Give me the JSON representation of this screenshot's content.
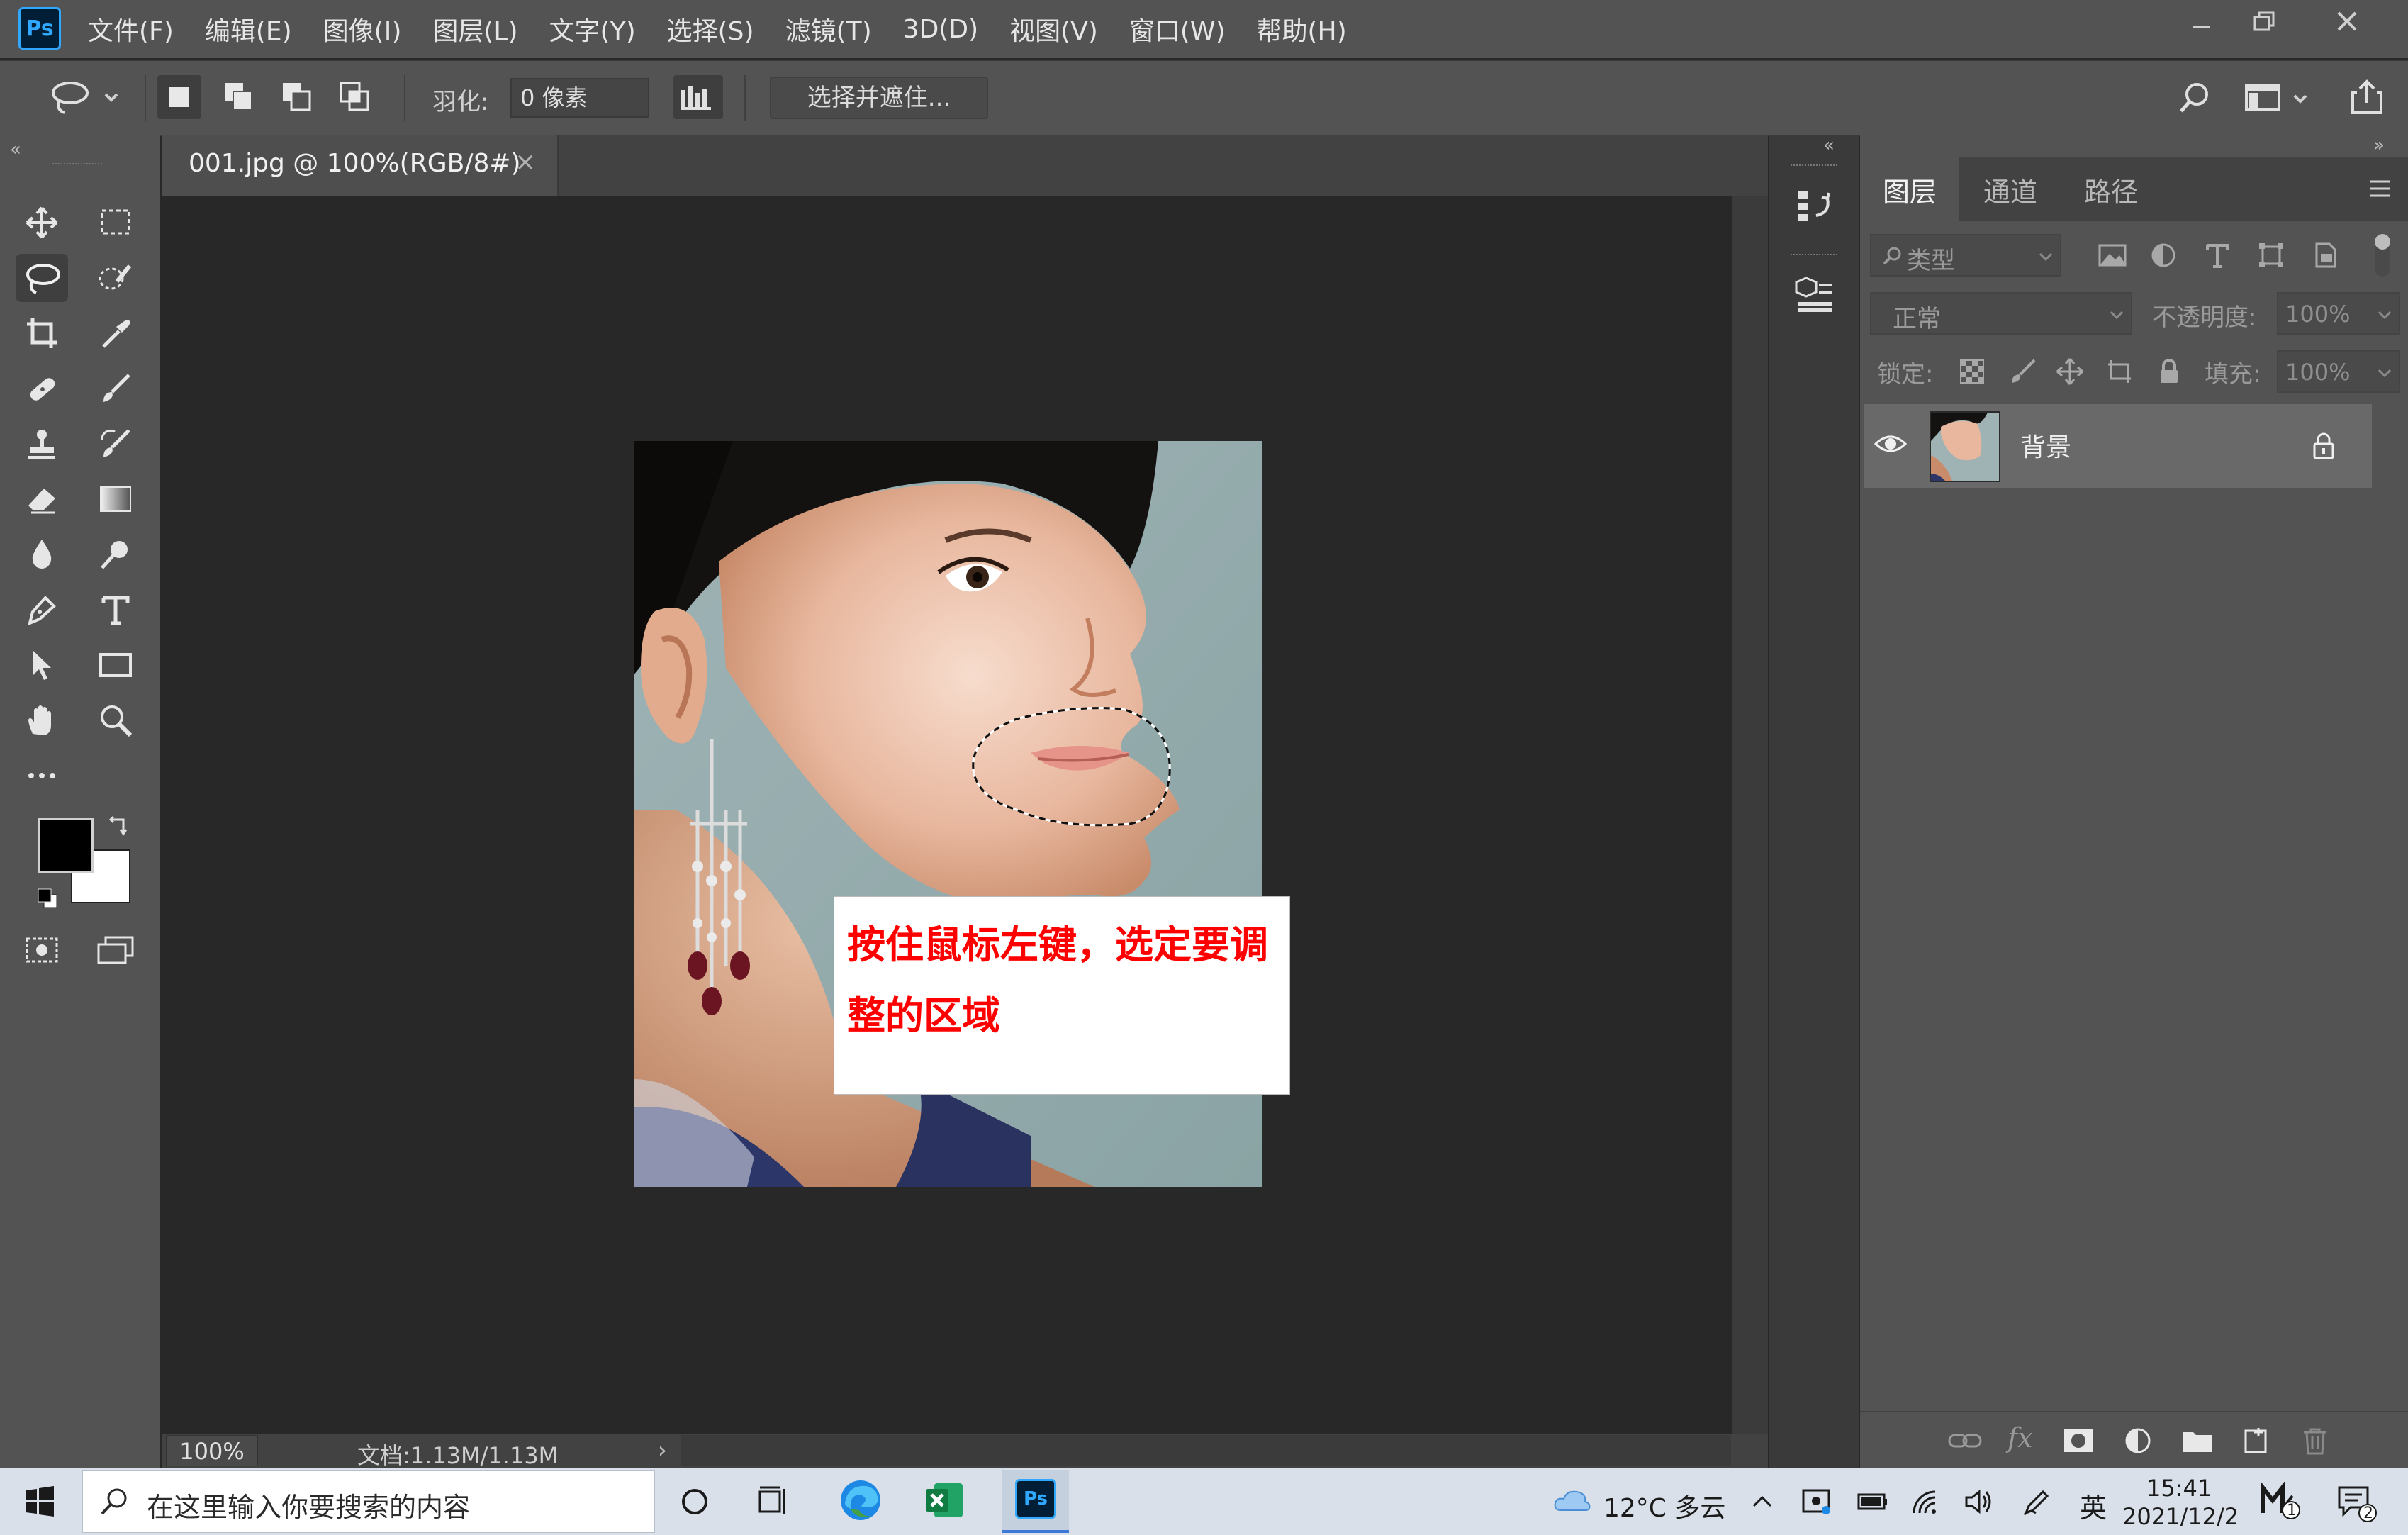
{
  "app": {
    "logo": "Ps",
    "menu": [
      "文件(F)",
      "编辑(E)",
      "图像(I)",
      "图层(L)",
      "文字(Y)",
      "选择(S)",
      "滤镜(T)",
      "3D(D)",
      "视图(V)",
      "窗口(W)",
      "帮助(H)"
    ]
  },
  "options": {
    "feather_label": "羽化:",
    "feather_value": "0 像素",
    "select_mask": "选择并遮住..."
  },
  "document": {
    "tab_title": "001.jpg @ 100%(RGB/8#)",
    "close": "×",
    "zoom": "100%",
    "doc_info": "文档:1.13M/1.13M",
    "status_arrow": "›",
    "callout": "按住鼠标左键，选定要调整的区域"
  },
  "panels": {
    "tabs": [
      "图层",
      "通道",
      "路径"
    ],
    "filter_placeholder": "类型",
    "blend_mode": "正常",
    "opacity_label": "不透明度:",
    "opacity_value": "100%",
    "lock_label": "锁定:",
    "fill_label": "填充:",
    "fill_value": "100%",
    "layers": [
      {
        "name": "背景",
        "visible": true,
        "locked": true
      }
    ]
  },
  "taskbar": {
    "search_placeholder": "在这里输入你要搜索的内容",
    "weather": "12°C 多云",
    "ime": "英",
    "time": "15:41",
    "date": "2021/12/2",
    "notification_count": "2",
    "badge": "1"
  },
  "colors": {
    "chrome": "#535353",
    "canvas": "#282828",
    "accent": "#31a8ff",
    "callout_text": "#ff0000"
  }
}
